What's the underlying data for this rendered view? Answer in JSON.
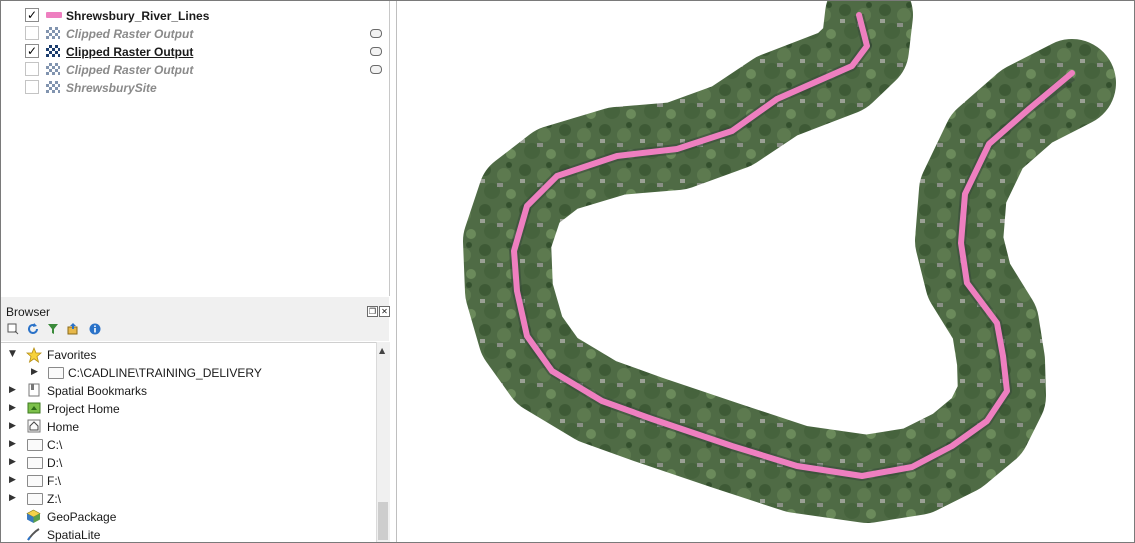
{
  "layers_panel": {
    "items": [
      {
        "label": "Shrewsbury_River_Lines",
        "checked": true,
        "symbol": "pink-line-symbol",
        "style": "bold"
      },
      {
        "label": "Clipped Raster Output",
        "checked": false,
        "symbol": "raster-icon",
        "style": "italic-grey"
      },
      {
        "label": "Clipped Raster Output",
        "checked": true,
        "symbol": "raster-icon",
        "style": "bold-underline"
      },
      {
        "label": "Clipped Raster Output",
        "checked": false,
        "symbol": "raster-icon",
        "style": "italic-grey"
      },
      {
        "label": "ShrewsburySite",
        "checked": false,
        "symbol": "raster-icon",
        "style": "italic-grey"
      }
    ],
    "check_mark": "✓"
  },
  "browser_panel": {
    "title": "Browser",
    "toolbar_icons": [
      "add-selected-icon",
      "refresh-icon",
      "filter-icon",
      "collapse-all-icon",
      "info-icon"
    ],
    "tree": [
      {
        "label": "Favorites",
        "icon": "star-icon",
        "expanded": true,
        "level": 0
      },
      {
        "label": "C:\\CADLINE\\TRAINING_DELIVERY",
        "icon": "folder-icon",
        "expanded": false,
        "level": 1
      },
      {
        "label": "Spatial Bookmarks",
        "icon": "bookmarks-icon",
        "expanded": false,
        "level": 0
      },
      {
        "label": "Project Home",
        "icon": "project-home-icon",
        "expanded": false,
        "level": 0
      },
      {
        "label": "Home",
        "icon": "home-icon",
        "expanded": false,
        "level": 0
      },
      {
        "label": "C:\\",
        "icon": "folder-icon",
        "expanded": false,
        "level": 0
      },
      {
        "label": "D:\\",
        "icon": "folder-icon",
        "expanded": false,
        "level": 0
      },
      {
        "label": "F:\\",
        "icon": "folder-icon",
        "expanded": false,
        "level": 0
      },
      {
        "label": "Z:\\",
        "icon": "folder-icon",
        "expanded": false,
        "level": 0
      },
      {
        "label": "GeoPackage",
        "icon": "geopackage-icon",
        "expanded": null,
        "level": 0
      },
      {
        "label": "SpatiaLite",
        "icon": "spatialite-icon",
        "expanded": null,
        "level": 0
      }
    ]
  },
  "colors": {
    "river_line": "#ee7fc0",
    "imagery_green": "#4f6b45",
    "panel_bg": "#f0f0f0"
  }
}
